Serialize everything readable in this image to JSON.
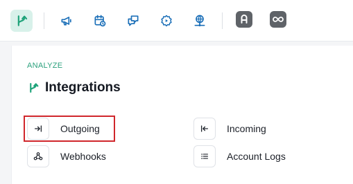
{
  "toolbar": {
    "items": [
      {
        "name": "integrations",
        "icon": "branch-icon",
        "active": true
      },
      {
        "name": "campaigns",
        "icon": "megaphone-icon"
      },
      {
        "name": "schedule",
        "icon": "calendar-clock-icon"
      },
      {
        "name": "conversations",
        "icon": "chat-bubbles-icon"
      },
      {
        "name": "automation",
        "icon": "gear-play-icon"
      },
      {
        "name": "network",
        "icon": "globe-network-icon"
      }
    ],
    "apps": [
      {
        "name": "app-one",
        "icon": "letter-a-icon"
      },
      {
        "name": "app-two",
        "icon": "infinity-icon"
      }
    ]
  },
  "panel": {
    "section_label": "ANALYZE",
    "title": "Integrations",
    "items": [
      {
        "label": "Outgoing",
        "icon": "arrow-right-in-icon"
      },
      {
        "label": "Incoming",
        "icon": "arrow-left-in-icon"
      },
      {
        "label": "Webhooks",
        "icon": "webhook-icon"
      },
      {
        "label": "Account Logs",
        "icon": "list-icon"
      }
    ]
  },
  "colors": {
    "accent": "#1fa37a",
    "icon_blue": "#1b6fb8",
    "active_bg": "#d8f1ea",
    "highlight": "#d0262b"
  }
}
